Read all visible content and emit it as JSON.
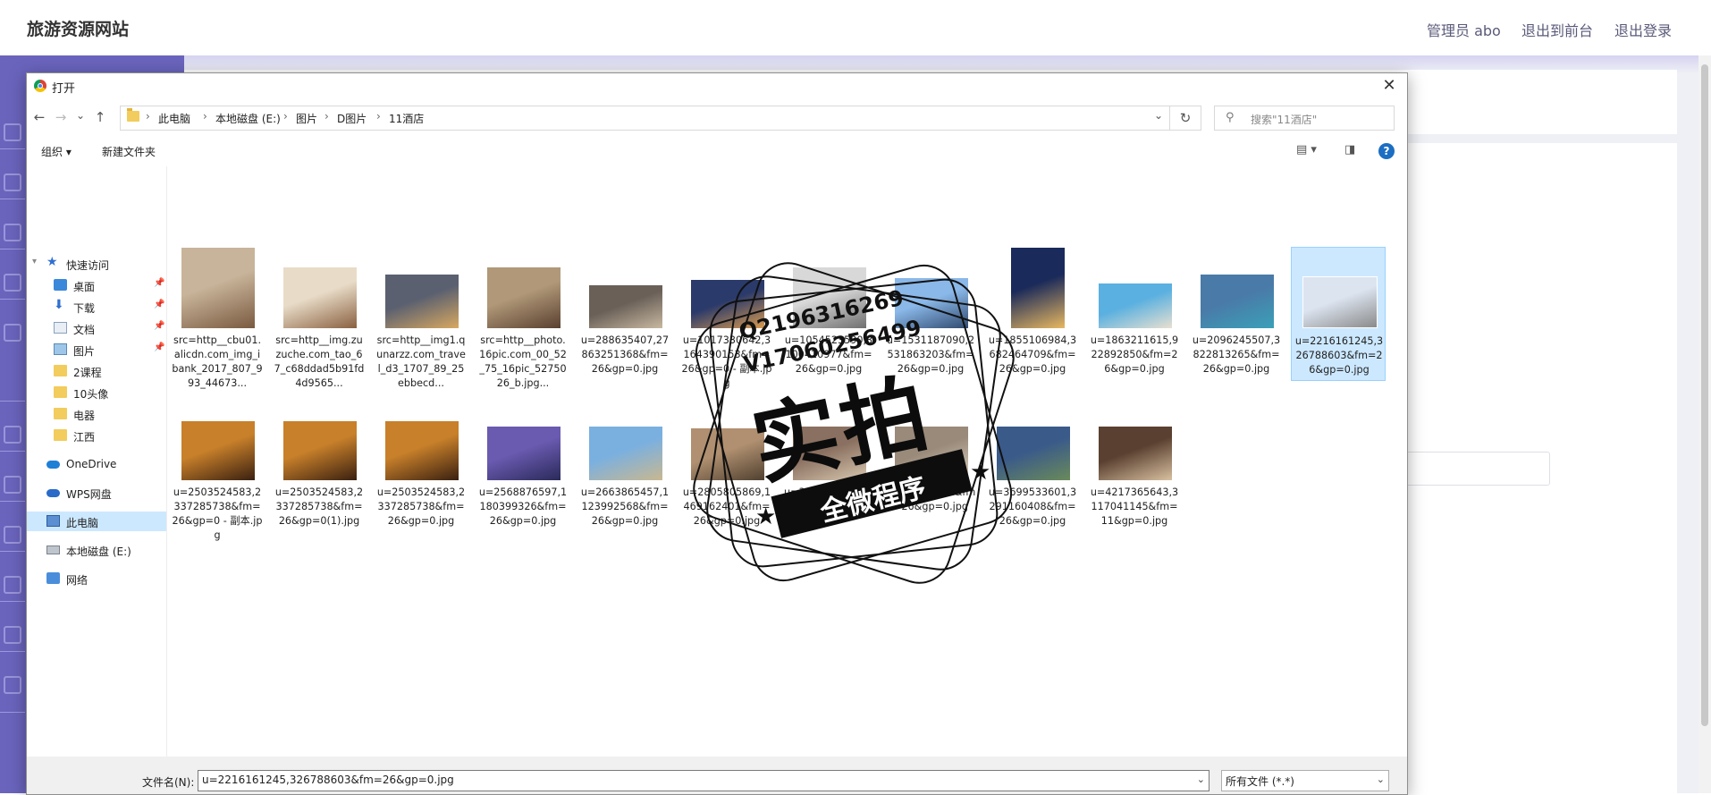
{
  "app": {
    "brand": "旅游资源网站",
    "header_links": [
      "管理员 abo",
      "退出到前台",
      "退出登录"
    ]
  },
  "dialog": {
    "title": "打开",
    "close_glyph": "✕",
    "nav": {
      "back": "←",
      "forward": "→",
      "recent": "⌄",
      "up": "↑"
    },
    "breadcrumb": [
      "此电脑",
      "本地磁盘 (E:)",
      "图片",
      "D图片",
      "11酒店"
    ],
    "search_placeholder": "搜索\"11酒店\"",
    "commands": {
      "organize": "组织 ▾",
      "new_folder": "新建文件夹"
    },
    "nav_pane": [
      {
        "label": "快速访问",
        "icon": "star-icon"
      },
      {
        "label": "桌面",
        "icon": "desktop-icon",
        "pinned": true
      },
      {
        "label": "下载",
        "icon": "download-icon",
        "pinned": true
      },
      {
        "label": "文档",
        "icon": "document-icon",
        "pinned": true
      },
      {
        "label": "图片",
        "icon": "pictures-icon",
        "pinned": true
      },
      {
        "label": "2课程",
        "icon": "folder-icon"
      },
      {
        "label": "10头像",
        "icon": "folder-icon"
      },
      {
        "label": "电器",
        "icon": "folder-icon"
      },
      {
        "label": "江西",
        "icon": "folder-icon"
      },
      {
        "label": "OneDrive",
        "icon": "onedrive-icon"
      },
      {
        "label": "WPS网盘",
        "icon": "wps-cloud-icon"
      },
      {
        "label": "此电脑",
        "icon": "this-pc-icon",
        "selected": true
      },
      {
        "label": "本地磁盘 (E:)",
        "icon": "drive-icon"
      },
      {
        "label": "网络",
        "icon": "network-icon"
      }
    ],
    "files": [
      {
        "name": "src=http__cbu01.alicdn.com_img_ibank_2017_807_993_44673...",
        "colors": [
          "#c8b49a",
          "#7a5a40"
        ]
      },
      {
        "name": "src=http__img.zuzuche.com_tao_67_c68ddad5b91fd4d9565...",
        "colors": [
          "#e8dcc8",
          "#8a6040"
        ]
      },
      {
        "name": "src=http__img1.qunarzz.com_travel_d3_1707_89_25ebbecd...",
        "colors": [
          "#5a6070",
          "#d8a860"
        ]
      },
      {
        "name": "src=http__photo.16pic.com_00_52_75_16pic_5275026_b.jpg...",
        "colors": [
          "#b09878",
          "#5a4030"
        ]
      },
      {
        "name": "u=288635407,27863251368&fm=26&gp=0.jpg",
        "colors": [
          "#6a6058",
          "#c8b8a0"
        ]
      },
      {
        "name": "u=1017330642,3164390153&fm=26&gp=0 - 副本.jpg",
        "colors": [
          "#2a3a6a",
          "#d89a50"
        ]
      },
      {
        "name": "u=1054523590,3100410977&fm=26&gp=0.jpg",
        "colors": [
          "#d8d8d8",
          "#707070"
        ]
      },
      {
        "name": "u=1531187090,2531863203&fm=26&gp=0.jpg",
        "colors": [
          "#8ab8e8",
          "#304a70"
        ]
      },
      {
        "name": "u=1855106984,3682464709&fm=26&gp=0.jpg",
        "colors": [
          "#1a2a5a",
          "#e8b860"
        ]
      },
      {
        "name": "u=1863211615,922892850&fm=26&gp=0.jpg",
        "colors": [
          "#5ab0e0",
          "#e8e0d0"
        ]
      },
      {
        "name": "u=2096245507,3822813265&fm=26&gp=0.jpg",
        "colors": [
          "#4a7aa8",
          "#3aa0b8"
        ]
      },
      {
        "name": "u=2216161245,326788603&fm=26&gp=0.jpg",
        "colors": [
          "#dce4f0",
          "#8a8a8a"
        ],
        "selected": true
      },
      {
        "name": "u=2503524583,2337285738&fm=26&gp=0 - 副本.jpg",
        "colors": [
          "#c8802a",
          "#3a2010"
        ]
      },
      {
        "name": "u=2503524583,2337285738&fm=26&gp=0(1).jpg",
        "colors": [
          "#c8802a",
          "#3a2010"
        ]
      },
      {
        "name": "u=2503524583,2337285738&fm=26&gp=0.jpg",
        "colors": [
          "#c8802a",
          "#3a2010"
        ]
      },
      {
        "name": "u=2568876597,1180399326&fm=26&gp=0.jpg",
        "colors": [
          "#6a5ab0",
          "#2a2a5a"
        ]
      },
      {
        "name": "u=2663865457,1123992568&fm=26&gp=0.jpg",
        "colors": [
          "#7ab0e0",
          "#c8b890"
        ]
      },
      {
        "name": "u=2805805869,1469162401&fm=26&gp=0.jpg",
        "colors": [
          "#b09070",
          "#504030"
        ]
      },
      {
        "name": "u=3102133088,&fm=26&gp=0.jpg",
        "colors": [
          "#8a7060",
          "#d8c8b0"
        ]
      },
      {
        "name": "u=3207088,1&fm=26&gp=0.jpg",
        "colors": [
          "#9a8a7a",
          "#d8d0c0"
        ]
      },
      {
        "name": "u=3699533601,3291160408&fm=26&gp=0.jpg",
        "colors": [
          "#3a5a8a",
          "#6a8a5a"
        ]
      },
      {
        "name": "u=4217365643,3117041145&fm=11&gp=0.jpg",
        "colors": [
          "#5a4030",
          "#d8c0a0"
        ]
      }
    ],
    "filename_label": "文件名(N):",
    "filename_value": "u=2216161245,326788603&fm=26&gp=0.jpg",
    "filter_value": "所有文件 (*.*)"
  },
  "watermark": {
    "line1": "Q2196316269",
    "line2": "V17060256499",
    "big": "实拍",
    "ribbon": "全微程序"
  }
}
